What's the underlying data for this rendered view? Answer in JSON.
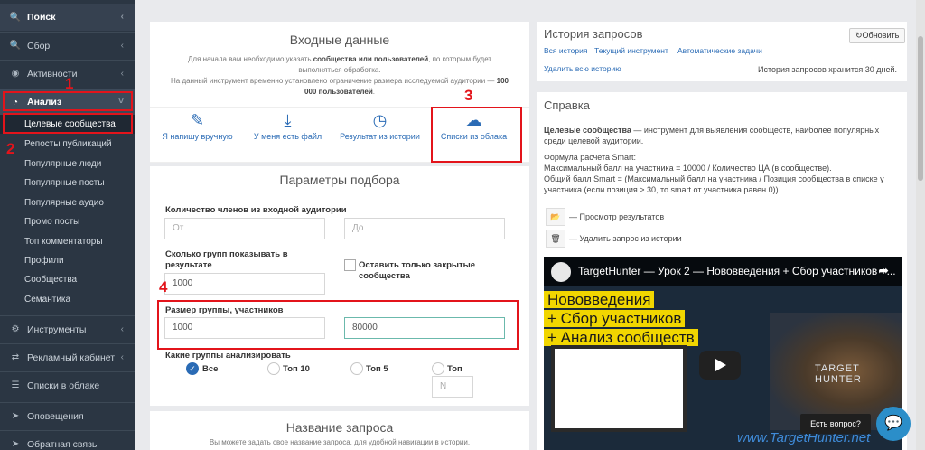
{
  "sidebar": {
    "search": "Поиск",
    "collect": "Сбор",
    "activities": "Активности",
    "analysis": "Анализ",
    "sub": [
      "Целевые сообщества",
      "Репосты публикаций",
      "Популярные люди",
      "Популярные посты",
      "Популярные аудио",
      "Промо посты",
      "Топ комментаторы",
      "Профили",
      "Сообщества",
      "Семантика"
    ],
    "tools": "Инструменты",
    "ad_cabinet": "Рекламный кабинет",
    "cloud_lists": "Списки в облаке",
    "notifications": "Оповещения",
    "feedback": "Обратная связь"
  },
  "annotations": [
    "1",
    "2",
    "3",
    "4"
  ],
  "input_section": {
    "title": "Входные данные",
    "desc_pre": "Для начала вам необходимо указать ",
    "desc_b1": "сообщества или пользователей",
    "desc_post": ", по которым будет выполняться обработка.",
    "limit_pre": "На данный инструмент временно установлено ограничение размера исследуемой аудитории — ",
    "limit_b": "100 000 пользователей",
    "limit_post": ".",
    "options": [
      "Я напишу вручную",
      "У меня есть файл",
      "Результат из истории",
      "Списки из облака"
    ]
  },
  "params": {
    "title": "Параметры подбора",
    "members_label": "Количество членов из входной аудитории",
    "from_ph": "От",
    "to_ph": "До",
    "groups_count_label": "Сколько групп показывать в результате",
    "groups_count_value": "1000",
    "closed_only_label": "Оставить только закрытые сообщества",
    "size_label": "Размер группы, участников",
    "size_from": "1000",
    "size_to": "80000",
    "which_label": "Какие группы анализировать",
    "radio": [
      "Все",
      "Топ 10",
      "Топ 5",
      "Топ"
    ],
    "top_n_ph": "N"
  },
  "request_name": {
    "title": "Название запроса",
    "desc": "Вы можете задать свое название запроса, для удобной навигации в истории."
  },
  "history": {
    "title": "История запросов",
    "refresh": "Обновить",
    "tabs": [
      "Вся история",
      "Текущий инструмент",
      "Автоматические задачи"
    ],
    "delete_all": "Удалить всю историю",
    "retention": "История запросов хранится 30 дней."
  },
  "help": {
    "title": "Справка",
    "lead_b": "Целевые сообщества",
    "lead": " — инструмент для выявления сообществ, наиболее популярных среди целевой аудитории.",
    "formula_title": "Формула расчета Smart:",
    "formula1": "Максимальный балл на участника = 10000 / Количество ЦА (в сообществе).",
    "formula2": "Общий балл Smart = (Максимальный балл на участника / Позиция сообщества в списке у участника (если позиция > 30, то smart от участника равен 0)).",
    "view_results": "— Просмотр результатов",
    "delete_request": "— Удалить запрос из истории"
  },
  "video": {
    "title": "TargetHunter — Урок 2 — Нововведения + Сбор участников +...",
    "line1": "Нововведения",
    "line2": "+ Сбор участников",
    "line3": "+ Анализ сообществ",
    "logo": "TARGET HUNTER",
    "watermark": "www.TargetHunter.net"
  },
  "chat": {
    "bubble": "Есть вопрос?"
  }
}
